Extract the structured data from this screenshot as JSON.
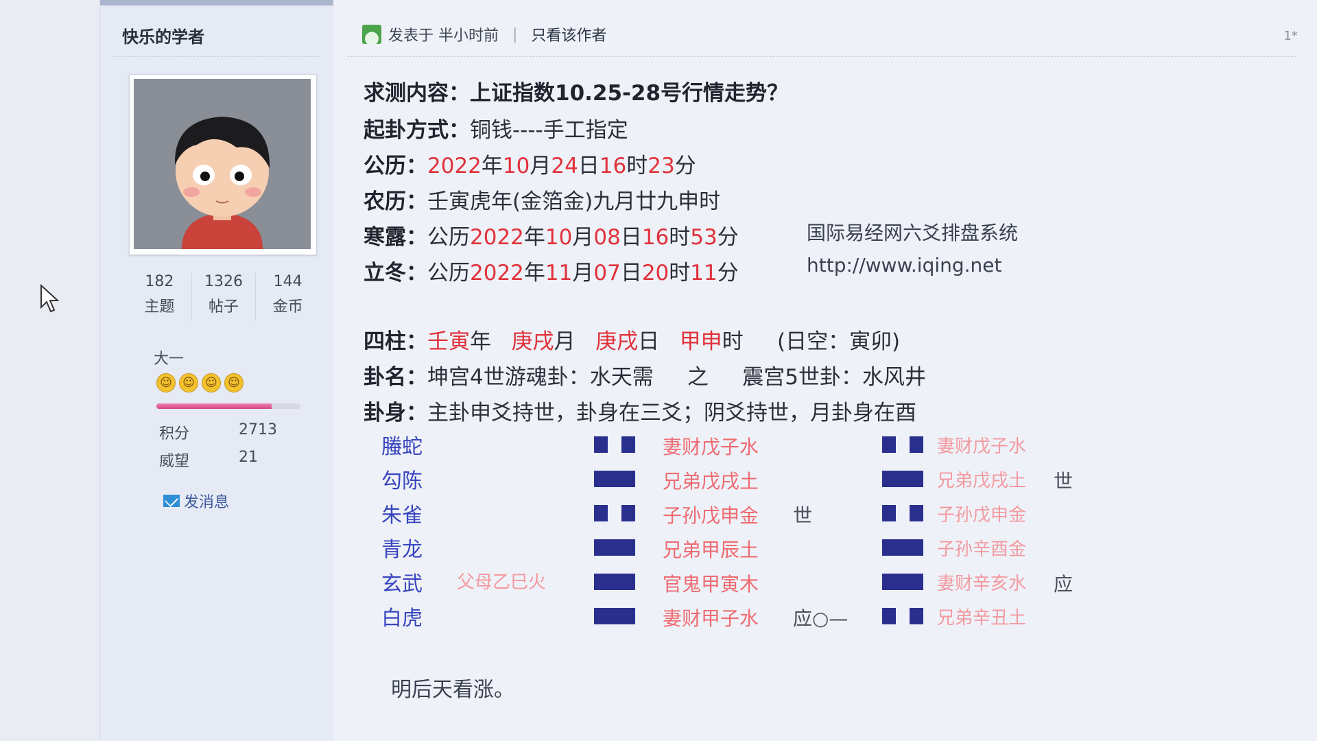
{
  "sidebar": {
    "username": "快乐的学者",
    "stats": [
      {
        "value": "182",
        "label": "主题"
      },
      {
        "value": "1326",
        "label": "帖子"
      },
      {
        "value": "144",
        "label": "金币"
      }
    ],
    "rank": "大一",
    "smiley_count": 4,
    "progress_fraction": 0.8,
    "points_label": "积分",
    "points_value": "2713",
    "prestige_label": "威望",
    "prestige_value": "21",
    "send_message": "发消息"
  },
  "header": {
    "posted_at": "发表于 半小时前",
    "separator": "|",
    "only_author": "只看该作者"
  },
  "post": {
    "query_label": "求测内容：",
    "query_value": "上证指数10.25-28号行情走势？",
    "method_label": "起卦方式：",
    "method_value": "铜钱----手工指定",
    "solar_label": "公历：",
    "solar_year": "2022",
    "solar_month": "10",
    "solar_day": "24",
    "solar_hour": "16",
    "solar_min": "23",
    "lunar_label": "农历：",
    "lunar_value": "壬寅虎年(金箔金)九月廿九申时",
    "hanlu_label": "寒露：",
    "hanlu_prefix": "公历",
    "hanlu_year": "2022",
    "hanlu_month": "10",
    "hanlu_day": "08",
    "hanlu_hour": "16",
    "hanlu_min": "53",
    "lidong_label": "立冬：",
    "lidong_prefix": "公历",
    "lidong_year": "2022",
    "lidong_month": "11",
    "lidong_day": "07",
    "lidong_hour": "20",
    "lidong_min": "11",
    "site_name": "国际易经网六爻排盘系统",
    "site_url": "http://www.iqing.net",
    "pillars_label": "四柱：",
    "pillar_year": "壬寅",
    "pillar_month": "庚戌",
    "pillar_day": "庚戌",
    "pillar_hour": "甲申",
    "unit_year": "年",
    "unit_month": "月",
    "unit_day": "日",
    "unit_hour": "时",
    "void": "(日空：寅卯)",
    "gua_name_label": "卦名：",
    "gua_main": "坤宫4世游魂卦：水天需",
    "zhi": "之",
    "gua_changed": "震宫5世卦：水风井",
    "gua_body_label": "卦身：",
    "gua_body_value": "主卦申爻持世，卦身在三爻；阴爻持世，月卦身在酉",
    "six_gods": [
      "螣蛇",
      "勾陈",
      "朱雀",
      "青龙",
      "玄武",
      "白虎"
    ],
    "hidden_relative": "父母乙巳火",
    "main_relatives": [
      "妻财戊子水",
      "兄弟戊戌土",
      "子孙戊申金",
      "兄弟甲辰土",
      "官鬼甲寅木",
      "妻财甲子水"
    ],
    "main_marks": [
      "",
      "",
      "世",
      "",
      "",
      "应○—"
    ],
    "changed_relatives": [
      "妻财戊子水",
      "兄弟戊戌土",
      "子孙戊申金",
      "子孙辛酉金",
      "妻财辛亥水",
      "兄弟辛丑土"
    ],
    "changed_marks": [
      "",
      "世",
      "",
      "",
      "应",
      ""
    ],
    "comment": "明后天看涨。",
    "corner_mark": "1*"
  }
}
